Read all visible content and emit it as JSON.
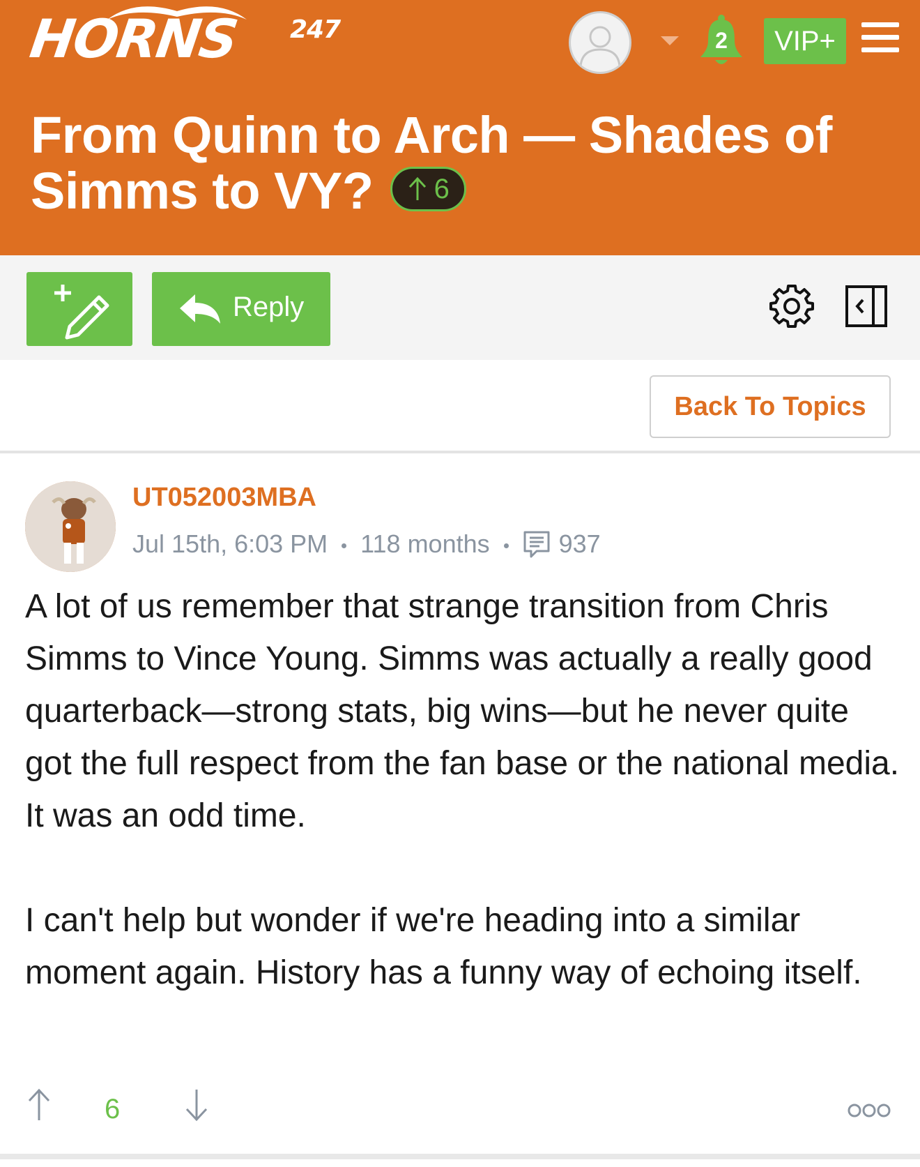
{
  "header": {
    "logo_word": "HORNS",
    "logo_number": "247",
    "notification_count": "2",
    "vip_label": "VIP+"
  },
  "thread": {
    "title": "From Quinn to Arch — Shades of Simms to VY?",
    "votes": "6"
  },
  "toolbar": {
    "reply_label": "Reply"
  },
  "nav": {
    "back_label": "Back To Topics"
  },
  "post": {
    "username": "UT052003MBA",
    "date": "Jul 15th, 6:03 PM",
    "tenure": "118 months",
    "post_count": "937",
    "paragraphs": [
      "A lot of us remember that strange transition from Chris Simms to Vince Young. Simms was actually a really good quarterback—strong stats, big wins—but he never quite got the full respect from the fan base or the national media. It was an odd time.",
      "I can't help but wonder if we're heading into a similar moment again. History has a funny way of echoing itself."
    ],
    "score": "6"
  },
  "colors": {
    "brand_orange": "#de6f21",
    "accent_green": "#6cc04a",
    "meta_gray": "#8a94a0"
  },
  "icons": [
    "user-avatar-icon",
    "chevron-down-icon",
    "bell-icon",
    "menu-icon",
    "new-post-icon",
    "reply-arrow-icon",
    "gear-icon",
    "sidebar-collapse-icon",
    "comment-icon",
    "upvote-icon",
    "downvote-icon",
    "more-icon"
  ]
}
